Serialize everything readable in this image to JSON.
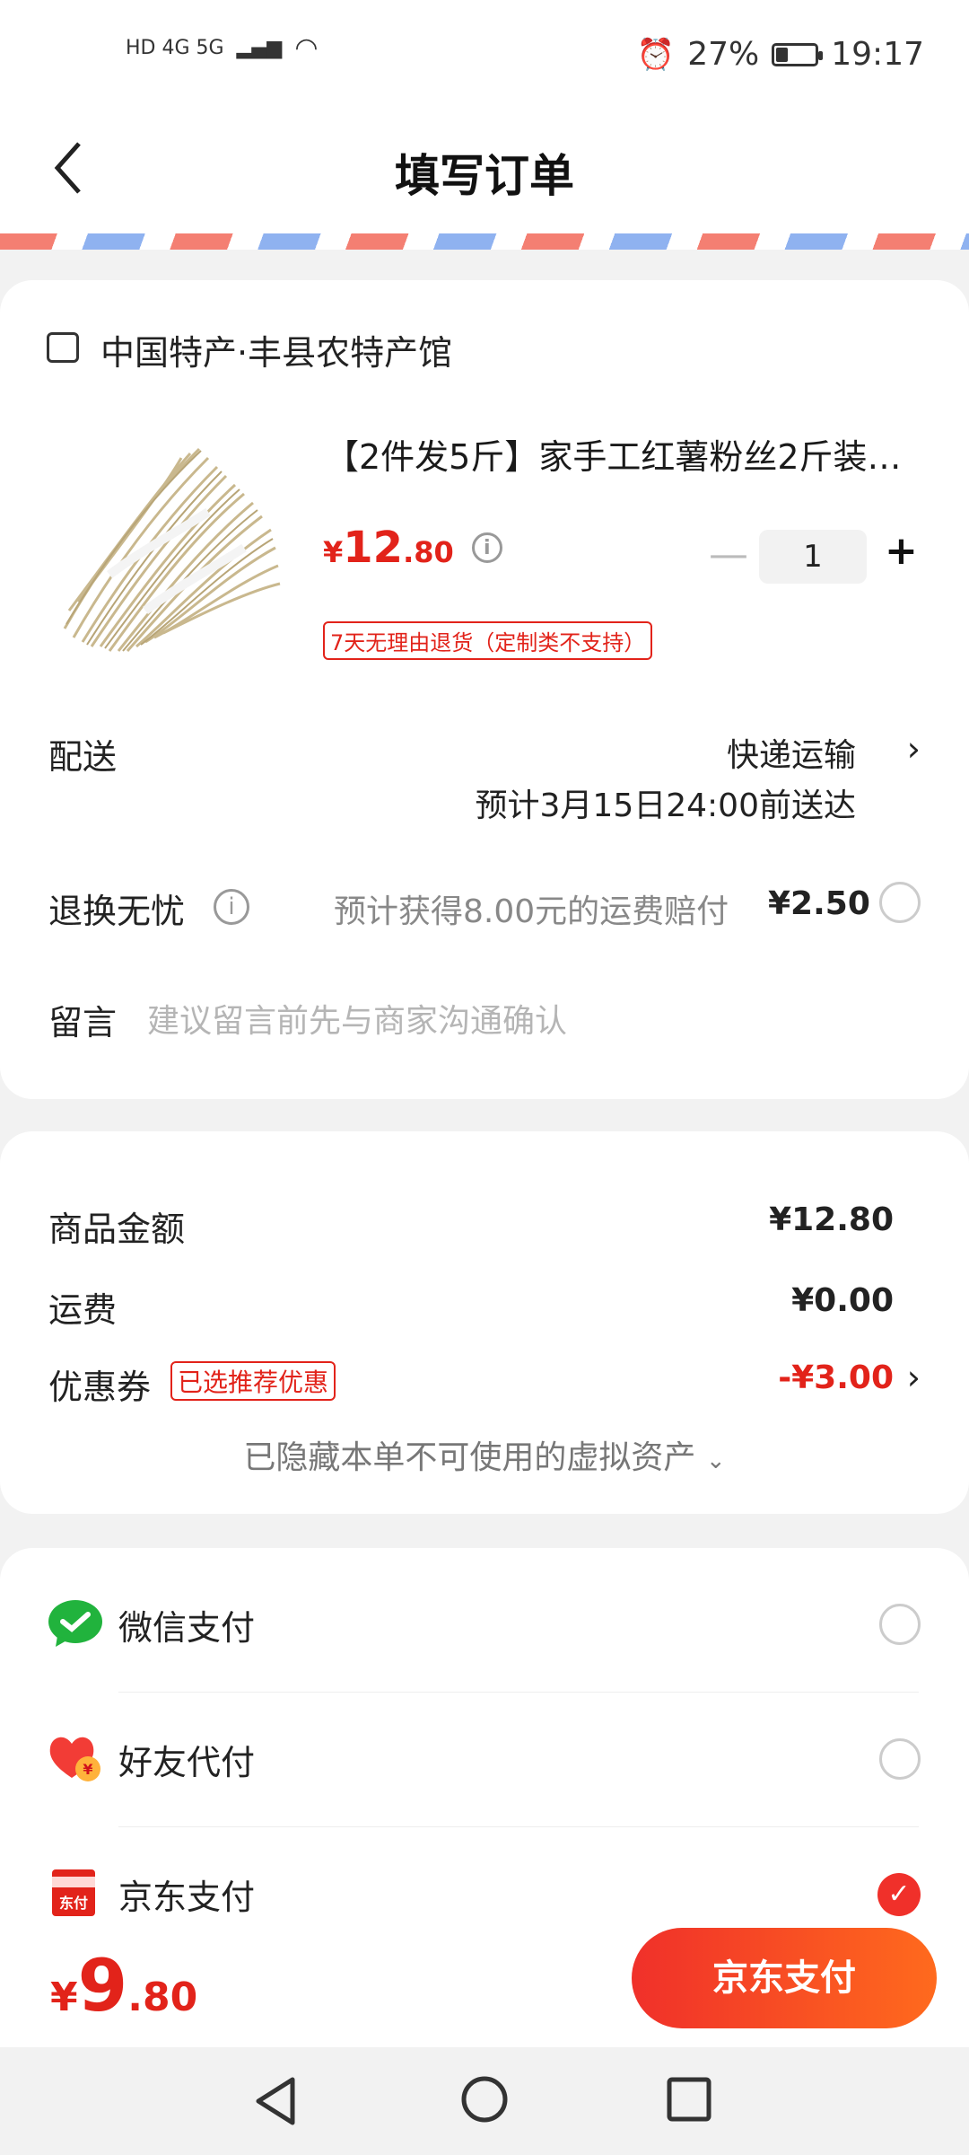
{
  "status_bar": {
    "left": "HD 4G 5G",
    "battery_text": "27%",
    "battery_level": 0.27,
    "time": "19:17"
  },
  "header": {
    "title": "填写订单",
    "back_icon": "chevron-left-icon"
  },
  "store": {
    "name": "中国特产·丰县农特产馆",
    "product_title": "【2件发5斤】家手工红薯粉丝2斤装…",
    "price_symbol": "¥",
    "price_int": "12",
    "price_dec": ".80",
    "quantity": "1",
    "return_tag": "7天无理由退货（定制类不支持）"
  },
  "delivery": {
    "label": "配送",
    "method": "快递运输",
    "eta": "预计3月15日24:00前送达"
  },
  "worry_free": {
    "label": "退换无忧",
    "desc": "预计获得8.00元的运费赔付",
    "price": "¥2.50"
  },
  "message": {
    "label": "留言",
    "placeholder": "建议留言前先与商家沟通确认"
  },
  "summary": {
    "goods_label": "商品金额",
    "goods_value": "¥12.80",
    "shipping_label": "运费",
    "shipping_value": "¥0.00",
    "coupon_label": "优惠券",
    "coupon_tag": "已选推荐优惠",
    "coupon_value": "-¥3.00",
    "hidden_assets": "已隐藏本单不可使用的虚拟资产"
  },
  "payment": {
    "methods": [
      {
        "label": "微信支付",
        "icon": "wechat-pay-icon",
        "selected": false
      },
      {
        "label": "好友代付",
        "icon": "friend-pay-icon",
        "selected": false
      },
      {
        "label": "京东支付",
        "icon": "jd-pay-icon",
        "icon_text": "东付",
        "selected": true
      }
    ]
  },
  "bottom": {
    "total_symbol": "¥",
    "total_int": "9",
    "total_dec": ".80",
    "pay_button": "京东支付"
  },
  "colors": {
    "accent": "#e2231a",
    "button_start": "#f0302a",
    "button_end": "#ff6a1d"
  }
}
